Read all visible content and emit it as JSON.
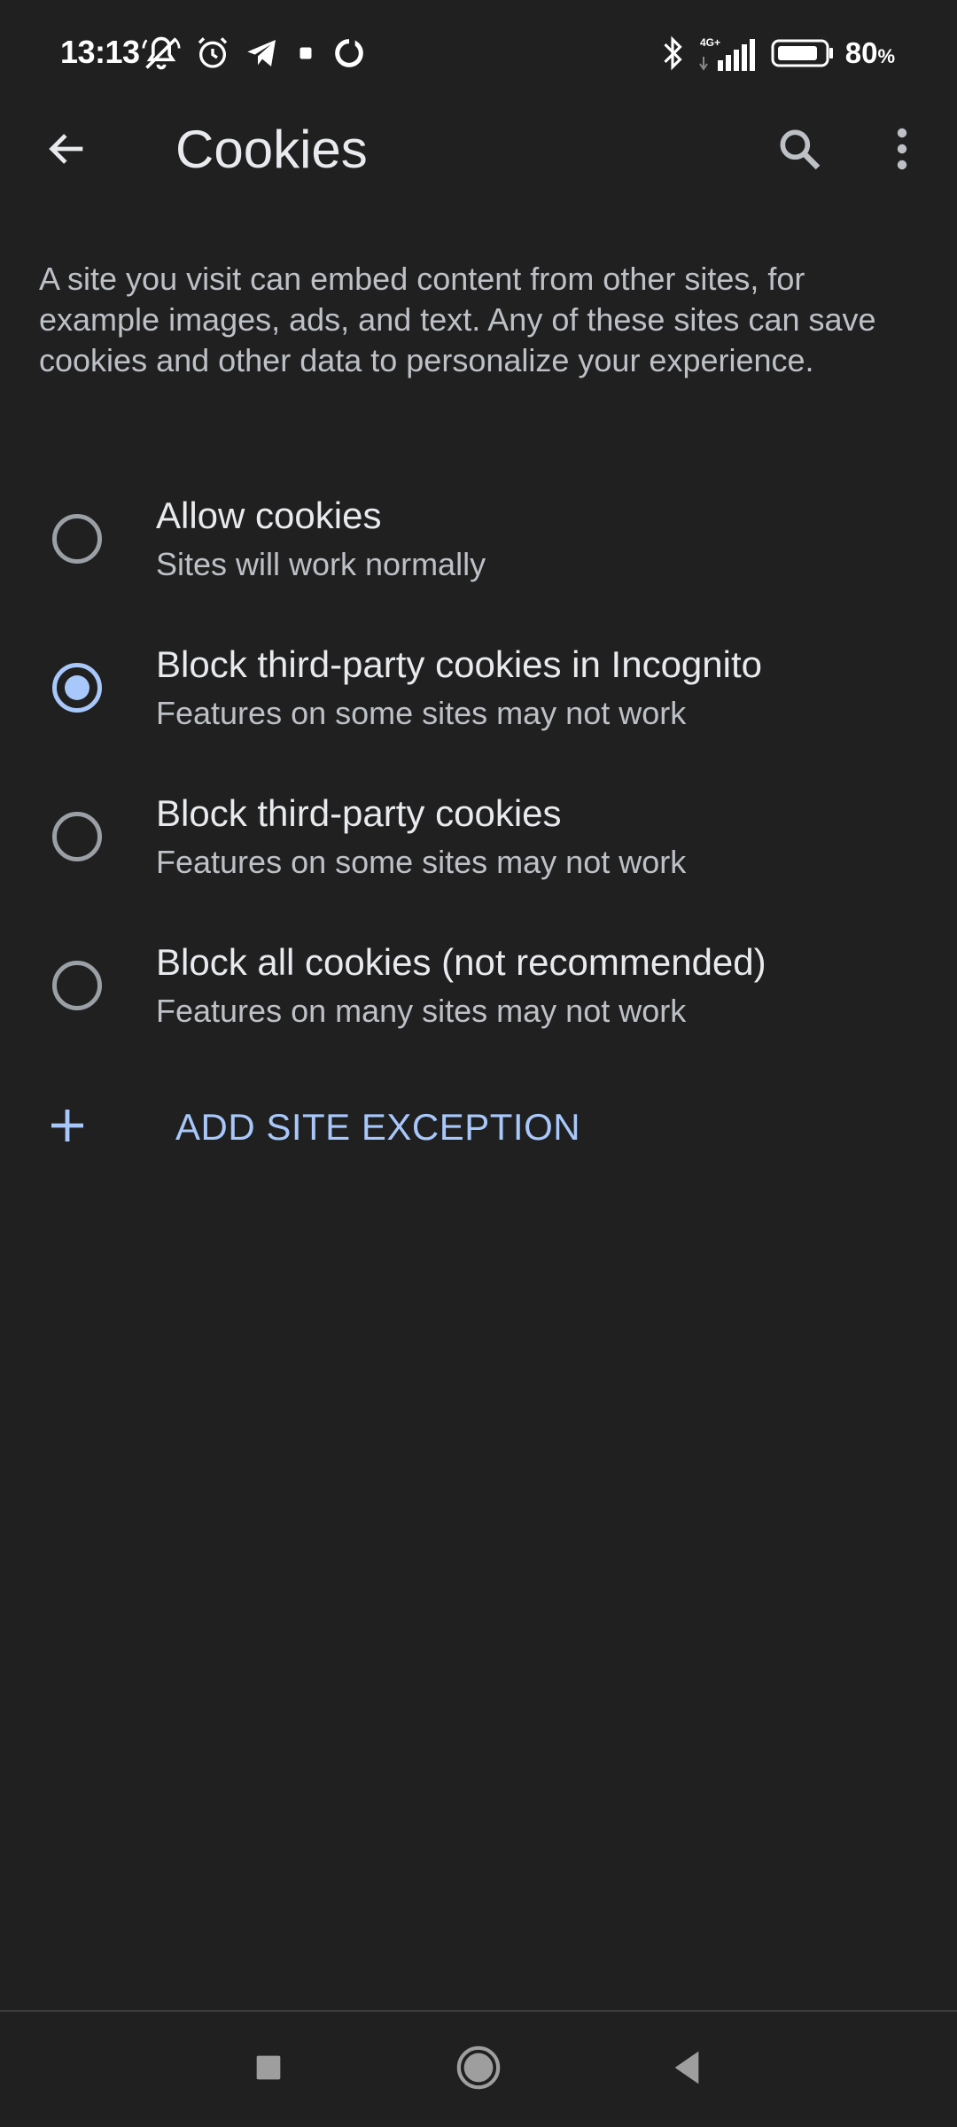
{
  "status_bar": {
    "time": "13:13",
    "battery_value": "80",
    "battery_unit": "%",
    "network_label": "4G+",
    "left_icons": [
      "muted-bell-icon",
      "alarm-icon",
      "telegram-icon",
      "small-square-icon",
      "ring-icon"
    ],
    "right_icons": [
      "bluetooth-icon",
      "signal-icon",
      "battery-icon"
    ]
  },
  "app_bar": {
    "title": "Cookies",
    "icons": [
      "back-arrow-icon",
      "search-icon",
      "more-vert-icon"
    ]
  },
  "description": "A site you visit can embed content from other sites, for example images, ads, and text. Any of these sites can save cookies and other data to personalize your experience.",
  "options": [
    {
      "title": "Allow cookies",
      "subtitle": "Sites will work normally",
      "selected": false
    },
    {
      "title": "Block third-party cookies in Incognito",
      "subtitle": "Features on some sites may not work",
      "selected": true
    },
    {
      "title": "Block third-party cookies",
      "subtitle": "Features on some sites may not work",
      "selected": false
    },
    {
      "title": "Block all cookies (not recommended)",
      "subtitle": "Features on many sites may not work",
      "selected": false
    }
  ],
  "add_exception": {
    "label": "ADD SITE EXCEPTION",
    "icon": "plus-icon"
  },
  "nav_bar": {
    "icons": [
      "recents-square-icon",
      "home-circle-icon",
      "back-triangle-icon"
    ]
  },
  "colors": {
    "background": "#202020",
    "accent": "#a8c7fa",
    "text_primary": "#e8eaed",
    "text_secondary": "#bdc1c6"
  }
}
